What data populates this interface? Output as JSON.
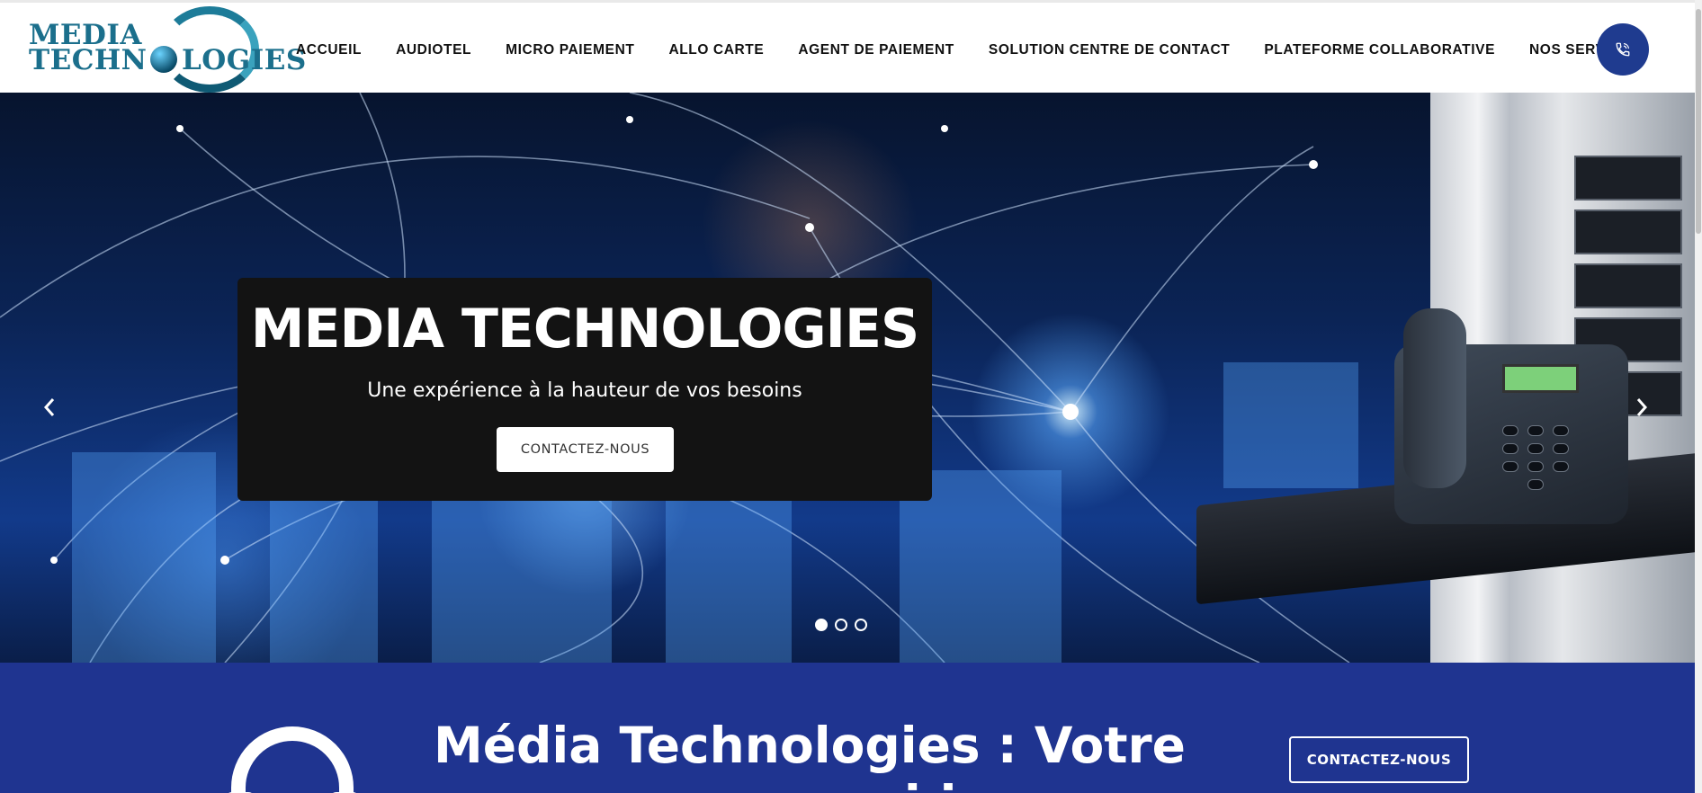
{
  "header": {
    "logo": {
      "line1": "MEDIA",
      "line2_start": "TECHN",
      "line2_end": "LOGIES"
    },
    "nav": [
      {
        "label": "ACCUEIL"
      },
      {
        "label": "AUDIOTEL"
      },
      {
        "label": "MICRO PAIEMENT"
      },
      {
        "label": "ALLO CARTE"
      },
      {
        "label": "AGENT DE PAIEMENT"
      },
      {
        "label": "SOLUTION CENTRE DE CONTACT"
      },
      {
        "label": "PLATEFORME COLLABORATIVE"
      },
      {
        "label": "NOS SERVICES"
      }
    ],
    "phone_icon": "phone-icon"
  },
  "hero": {
    "title": "MEDIA TECHNOLOGIES",
    "subtitle": "Une expérience à la hauteur de vos besoins",
    "button_label": "CONTACTEZ-NOUS",
    "arrows": {
      "prev_icon": "chevron-left-icon",
      "next_icon": "chevron-right-icon"
    },
    "slides": {
      "count": 3,
      "active_index": 0
    }
  },
  "band": {
    "title_line1": "Média Technologies : Votre",
    "title_line2": "p... m.... ... ..i.i..",
    "button_label": "CONTACTEZ-NOUS",
    "icon": "headset-icon"
  },
  "colors": {
    "brand_blue": "#1f3b8f",
    "band_blue": "#1f3490",
    "logo_teal": "#1b6f8c",
    "card_black": "#131313"
  }
}
